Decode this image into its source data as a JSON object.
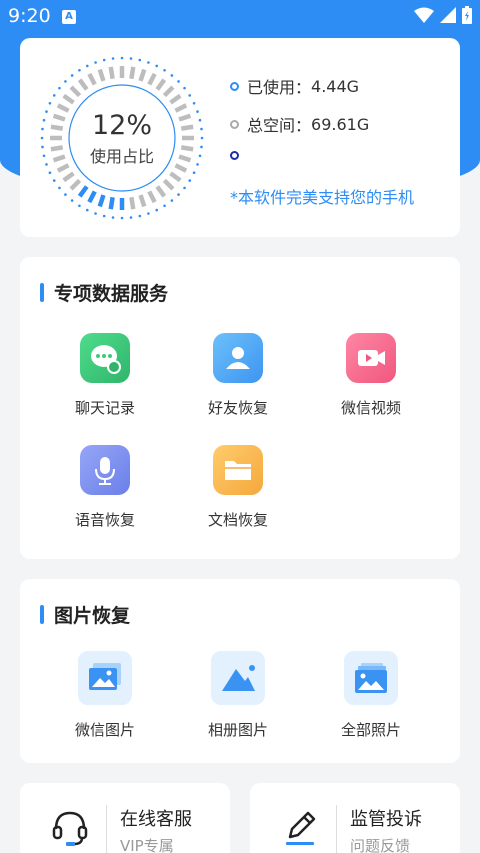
{
  "status_bar": {
    "time": "9:20",
    "notification_letter": "A"
  },
  "storage": {
    "percent_text": "12%",
    "percent_label": "使用占比",
    "used_fraction": 0.12,
    "used_label": "已使用：",
    "used_value": "4.44G",
    "total_label": "总空间：",
    "total_value": "69.61G",
    "note": "*本软件完美支持您的手机"
  },
  "services": {
    "title": "专项数据服务",
    "items": [
      {
        "label": "聊天记录",
        "icon": "chat-icon",
        "color": "#3ecb7a"
      },
      {
        "label": "好友恢复",
        "icon": "friends-icon",
        "color": "#4fa8f5"
      },
      {
        "label": "微信视频",
        "icon": "video-icon",
        "color": "#f56c8e"
      },
      {
        "label": "语音恢复",
        "icon": "microphone-icon",
        "color": "#7a8ff0"
      },
      {
        "label": "文档恢复",
        "icon": "folder-icon",
        "color": "#f9b94f"
      }
    ]
  },
  "photos": {
    "title": "图片恢复",
    "items": [
      {
        "label": "微信图片",
        "icon": "wechat-photo-icon"
      },
      {
        "label": "相册图片",
        "icon": "album-icon"
      },
      {
        "label": "全部照片",
        "icon": "all-photos-icon"
      }
    ]
  },
  "bottom": {
    "service": {
      "title": "在线客服",
      "subtitle": "VIP专属",
      "icon": "headset-icon"
    },
    "complaint": {
      "title": "监管投诉",
      "subtitle": "问题反馈",
      "icon": "pen-icon"
    }
  },
  "colors": {
    "accent": "#2d8df5",
    "used_ring": "#2d8df5",
    "free_ring": "#bdbdbd"
  }
}
